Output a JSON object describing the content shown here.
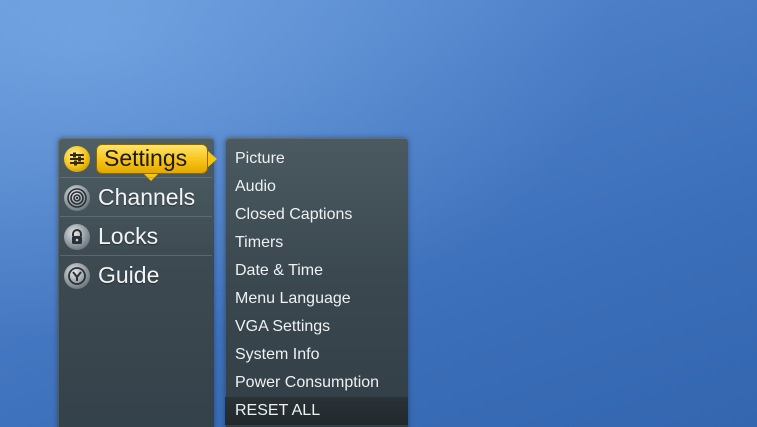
{
  "main_menu": {
    "items": [
      {
        "label": "Settings",
        "icon": "settings-sliders-icon",
        "selected": true
      },
      {
        "label": "Channels",
        "icon": "antenna-signal-icon",
        "selected": false
      },
      {
        "label": "Locks",
        "icon": "lock-icon",
        "selected": false
      },
      {
        "label": "Guide",
        "icon": "guide-icon",
        "selected": false
      }
    ]
  },
  "sub_menu": {
    "items": [
      {
        "label": "Picture"
      },
      {
        "label": "Audio"
      },
      {
        "label": "Closed Captions"
      },
      {
        "label": "Timers"
      },
      {
        "label": "Date & Time"
      },
      {
        "label": "Menu Language"
      },
      {
        "label": "VGA Settings"
      },
      {
        "label": "System Info"
      },
      {
        "label": "Power Consumption"
      },
      {
        "label": "RESET ALL"
      }
    ]
  },
  "colors": {
    "background": "#4a7dc6",
    "highlight": "#f5c518",
    "menu_panel": "#3d4a51"
  }
}
